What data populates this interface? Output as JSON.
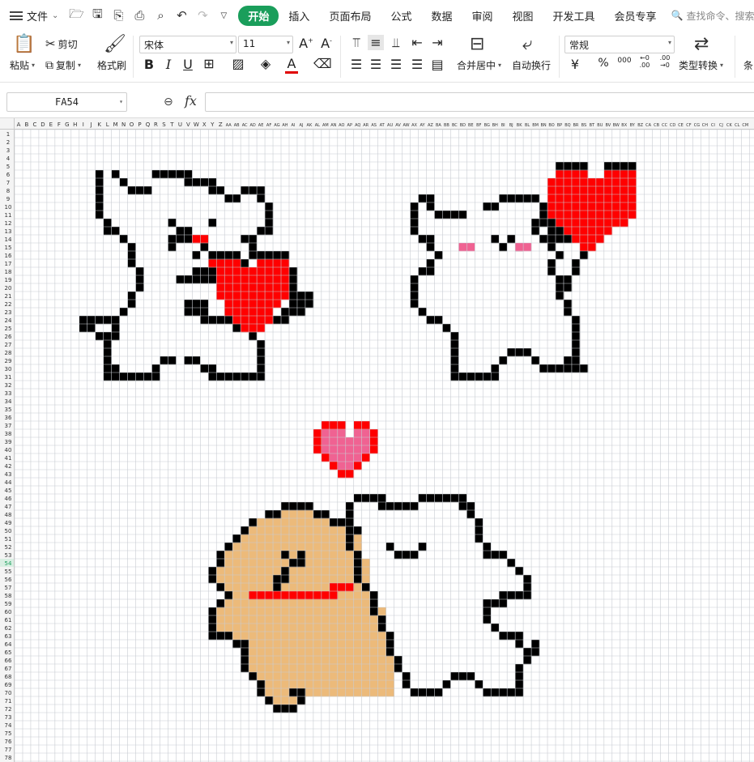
{
  "menubar": {
    "file_label": "文件",
    "quick_icons": [
      "open-icon",
      "save-icon",
      "export-pdf-icon",
      "print-icon",
      "print-preview-icon",
      "undo-icon",
      "redo-icon",
      "customize-icon"
    ],
    "tabs": [
      "开始",
      "插入",
      "页面布局",
      "公式",
      "数据",
      "审阅",
      "视图",
      "开发工具",
      "会员专享"
    ],
    "active_tab": "开始",
    "search_placeholder": "查找命令、搜索"
  },
  "ribbon": {
    "paste": "粘贴",
    "cut": "剪切",
    "copy": "复制",
    "format_painter": "格式刷",
    "font_name": "宋体",
    "font_size": "11",
    "merge_center": "合并居中",
    "wrap_text": "自动换行",
    "number_format": "常规",
    "type_convert": "类型转换",
    "conditional": "条",
    "percent": "%",
    "thousands": "000",
    "dec_inc": "←0 .00",
    "dec_dec": ".00 →0"
  },
  "formula_bar": {
    "name_box": "FA54",
    "fx_label": "fx",
    "formula_value": ""
  },
  "sheet": {
    "columns": [
      "A",
      "B",
      "C",
      "D",
      "E",
      "F",
      "G",
      "H",
      "I",
      "J",
      "K",
      "L",
      "M",
      "N",
      "O",
      "P",
      "Q",
      "R",
      "S",
      "T",
      "U",
      "V",
      "W",
      "X",
      "Y",
      "Z",
      "AA",
      "AB",
      "AC",
      "AD",
      "AE",
      "AF",
      "AG",
      "AH",
      "AI",
      "AJ",
      "AK",
      "AL",
      "AM",
      "AN",
      "AO",
      "AP",
      "AQ",
      "AR",
      "AS",
      "AT",
      "AU",
      "AV",
      "AW",
      "AX",
      "AY",
      "AZ",
      "BA",
      "BB",
      "BC",
      "BD",
      "BE",
      "BF",
      "BG",
      "BH",
      "BI",
      "BJ",
      "BK",
      "BL",
      "BM",
      "BN",
      "BO",
      "BP",
      "BQ",
      "BR",
      "BS",
      "BT",
      "BU",
      "BV",
      "BW",
      "BX",
      "BY",
      "BZ",
      "CA",
      "CB",
      "CC",
      "CD",
      "CE",
      "CF",
      "CG",
      "CH",
      "CI",
      "CJ",
      "CK",
      "CL",
      "CM"
    ],
    "row_count": 78,
    "selected_row": 54,
    "colors": {
      "outline": "#000000",
      "heart_red": "#ff0000",
      "heart_pink": "#f06292",
      "blush": "#f06292",
      "dog_fill": "#ecba7a",
      "collar": "#ff0000",
      "grid_line": "#c8ccd2"
    }
  }
}
